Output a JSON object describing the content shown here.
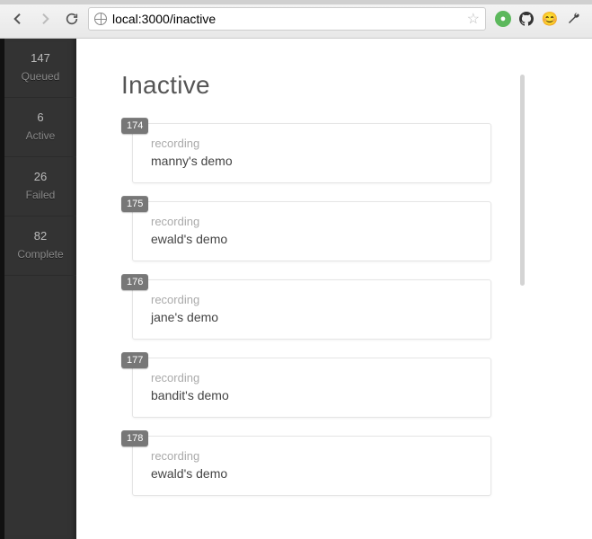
{
  "browser": {
    "url_display": "local:3000/inactive"
  },
  "sidebar": {
    "items": [
      {
        "count": "147",
        "label": "Queued"
      },
      {
        "count": "6",
        "label": "Active"
      },
      {
        "count": "26",
        "label": "Failed"
      },
      {
        "count": "82",
        "label": "Complete"
      }
    ]
  },
  "page": {
    "title": "Inactive"
  },
  "jobs": [
    {
      "id": "174",
      "type": "recording",
      "title": "manny's demo"
    },
    {
      "id": "175",
      "type": "recording",
      "title": "ewald's demo"
    },
    {
      "id": "176",
      "type": "recording",
      "title": "jane's demo"
    },
    {
      "id": "177",
      "type": "recording",
      "title": "bandit's demo"
    },
    {
      "id": "178",
      "type": "recording",
      "title": "ewald's demo"
    }
  ]
}
